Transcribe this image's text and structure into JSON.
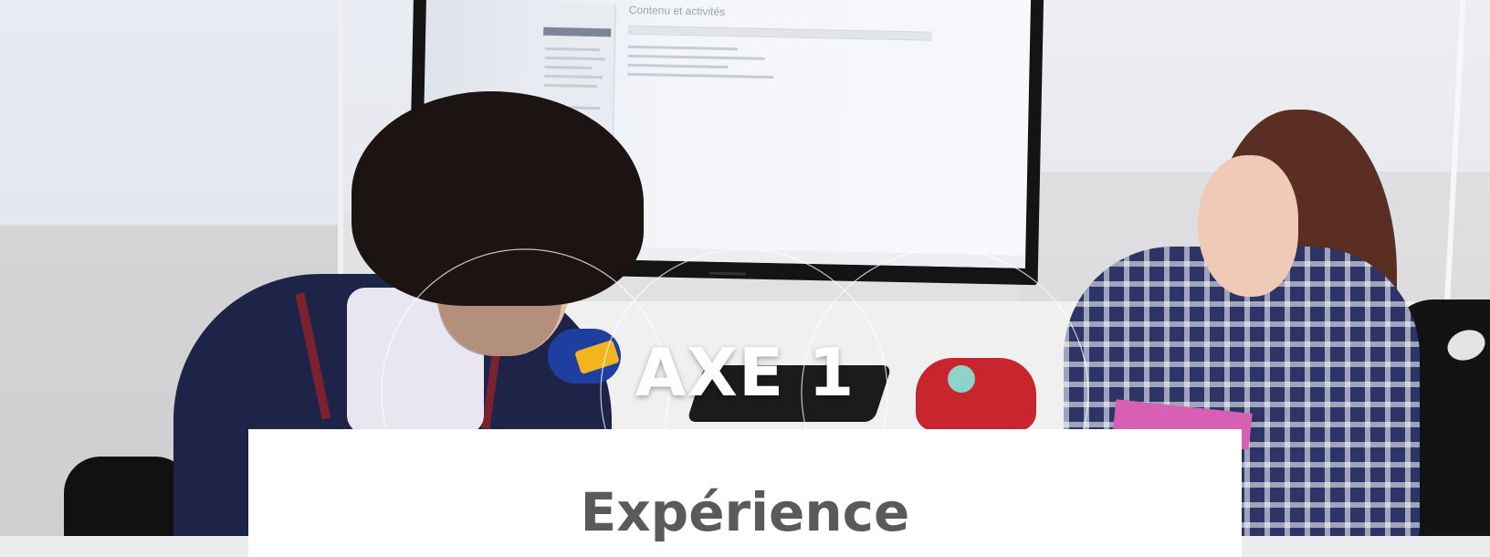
{
  "hero": {
    "screen_heading": "Contenu et activités",
    "image_alt": "Deux étudiants travaillant devant un écran interactif"
  },
  "overlay": {
    "axis_title": "AXE 1",
    "card_title": "Expérience"
  },
  "colors": {
    "title_white": "#ffffff",
    "card_background": "#ffffff",
    "card_text": "#5a5a5a",
    "circle_stroke": "#ffffff"
  }
}
